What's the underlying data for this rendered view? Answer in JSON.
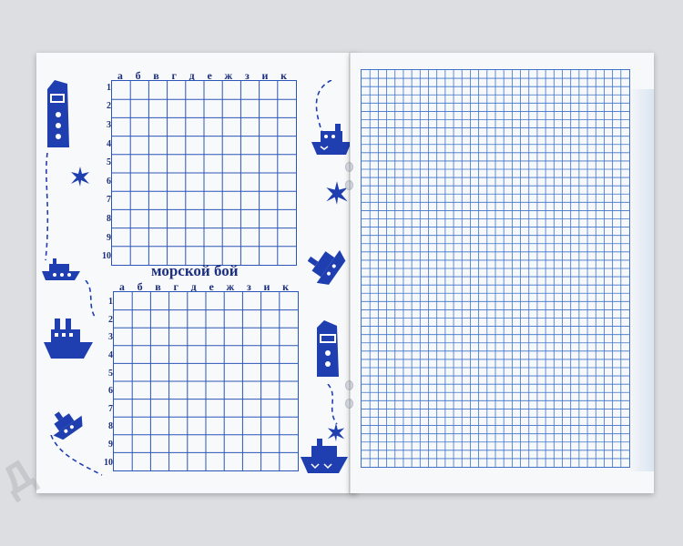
{
  "battle_sheet": {
    "letters": [
      "а",
      "б",
      "в",
      "г",
      "д",
      "е",
      "ж",
      "з",
      "и",
      "к"
    ],
    "numbers": [
      "1",
      "2",
      "3",
      "4",
      "5",
      "6",
      "7",
      "8",
      "9",
      "10"
    ],
    "title": "морской бой"
  },
  "watermark": "Д",
  "colors": {
    "print_blue": "#1c2f80",
    "grid_blue": "#2a56b8",
    "graph_paper_blue": "#3d72c9",
    "background": "#dcdee1"
  },
  "icons": [
    "ship-icon",
    "tugboat-icon",
    "steamship-icon",
    "star-icon",
    "dashed-route-icon"
  ]
}
